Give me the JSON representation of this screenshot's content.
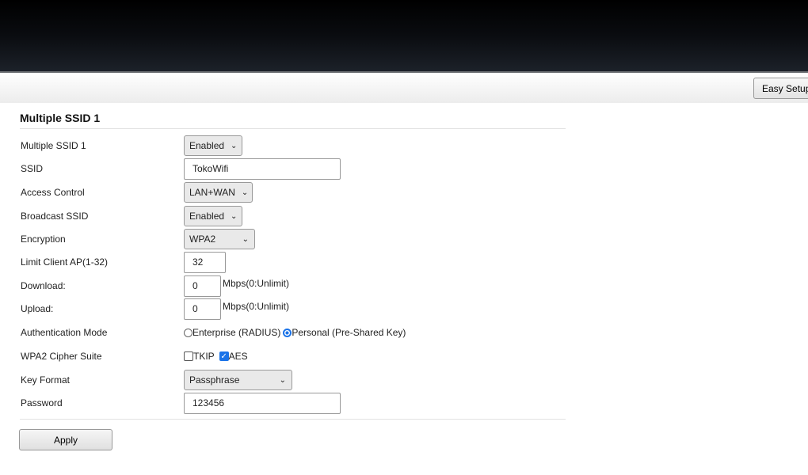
{
  "toolbar": {
    "easy_setup": "Easy Setup"
  },
  "section": {
    "title": "Multiple SSID 1"
  },
  "fields": {
    "multiple_ssid": {
      "label": "Multiple SSID 1",
      "value": "Enabled"
    },
    "ssid": {
      "label": "SSID",
      "value": "TokoWifi"
    },
    "access_control": {
      "label": "Access Control",
      "value": "LAN+WAN"
    },
    "broadcast_ssid": {
      "label": "Broadcast SSID",
      "value": "Enabled"
    },
    "encryption": {
      "label": "Encryption",
      "value": "WPA2"
    },
    "limit_client": {
      "label": "Limit Client AP(1-32)",
      "value": "32"
    },
    "download": {
      "label": "Download:",
      "value": "0",
      "unit": "Mbps(0:Unlimit)"
    },
    "upload": {
      "label": "Upload:",
      "value": "0",
      "unit": "Mbps(0:Unlimit)"
    },
    "auth_mode": {
      "label": "Authentication Mode",
      "options": [
        "Enterprise (RADIUS)",
        "Personal (Pre-Shared Key)"
      ],
      "selected": "Personal (Pre-Shared Key)"
    },
    "cipher": {
      "label": "WPA2 Cipher Suite",
      "tkip": "TKIP",
      "aes": "AES",
      "tkip_checked": false,
      "aes_checked": true
    },
    "key_format": {
      "label": "Key Format",
      "value": "Passphrase"
    },
    "password": {
      "label": "Password",
      "value": "123456"
    }
  },
  "apply_label": "Apply",
  "colors": {
    "accent": "#1a73e8",
    "header": "#000000"
  }
}
